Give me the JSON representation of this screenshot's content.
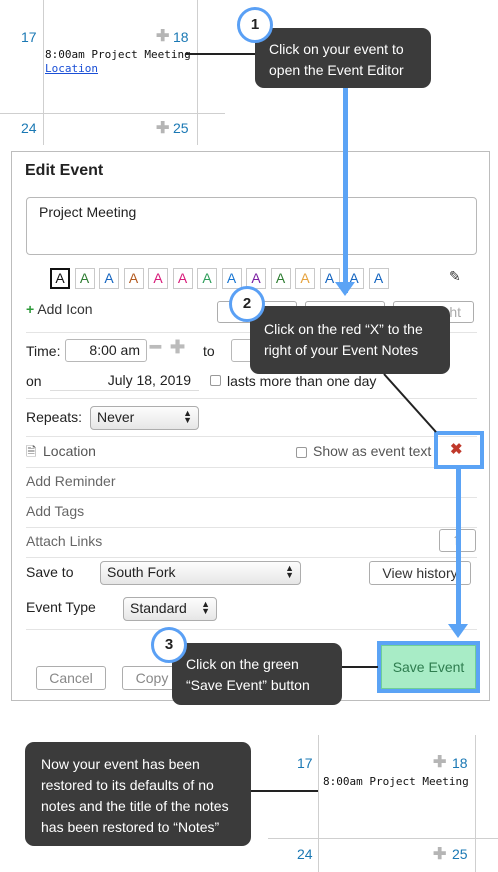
{
  "calendar_top": {
    "day_left": "17",
    "day_right": "18",
    "day_left_bottom": "24",
    "day_right_bottom": "25",
    "event_text": "8:00am Project Meeting",
    "event_link": "Location"
  },
  "edit_event": {
    "title": "Edit Event",
    "notes_value": "Project Meeting",
    "color_letter": "A",
    "color_swatches": [
      "#111111",
      "#2e7d32",
      "#1565c0",
      "#b35a1f",
      "#d81b7a",
      "#d81b7a",
      "#2e9e5b",
      "#1976d2",
      "#7b1fa2",
      "#2e7d32",
      "#e6a23c",
      "#1565c0",
      "#1565c0",
      "#1565c0"
    ],
    "add_icon": "Add Icon",
    "hidden_button_tail": "ght",
    "time_label": "Time:",
    "start_time": "8:00 am",
    "to_label": "to",
    "on_label": "on",
    "date": "July 18, 2019",
    "multi_day": "lasts more than one day",
    "repeats_label": "Repeats:",
    "repeats_value": "Never",
    "location_label": "Location",
    "show_as_event_text": "Show as event text",
    "add_reminder": "Add Reminder",
    "add_tags": "Add Tags",
    "attach_links": "Attach Links",
    "save_to_label": "Save to",
    "save_to_value": "South Fork",
    "view_history": "View history",
    "event_type_label": "Event Type",
    "event_type_value": "Standard",
    "cancel": "Cancel",
    "copy": "Copy",
    "save_event": "Save Event"
  },
  "callouts": {
    "step1_num": "1",
    "step1_line1": "Click on your event to",
    "step1_line2": "open the Event Editor",
    "step2_num": "2",
    "step2_line1": "Click on the red “X” to the",
    "step2_line2": "right of your Event Notes",
    "step3_num": "3",
    "step3_line1": "Click on the green",
    "step3_line2": "“Save Event” button",
    "result_line1": "Now your event has been",
    "result_line2": "restored to its defaults of no",
    "result_line3": "notes and the title of the notes",
    "result_line4": "has been restored to “Notes”"
  },
  "calendar_bottom": {
    "day_left": "17",
    "day_right": "18",
    "day_left_bottom": "24",
    "day_right_bottom": "25",
    "event_text": "8:00am Project Meeting"
  },
  "colors": {
    "callout_bg": "#3b3b3b",
    "highlight_blue": "#5ba3f5",
    "save_green": "#a8ecc6",
    "delete_red": "#c0392b",
    "day_number_blue": "#1a78b4"
  },
  "icons": [
    "plus-icon",
    "document-icon",
    "edit-pencil-icon",
    "delete-x-icon",
    "chevron-updown-icon",
    "minus-icon"
  ]
}
